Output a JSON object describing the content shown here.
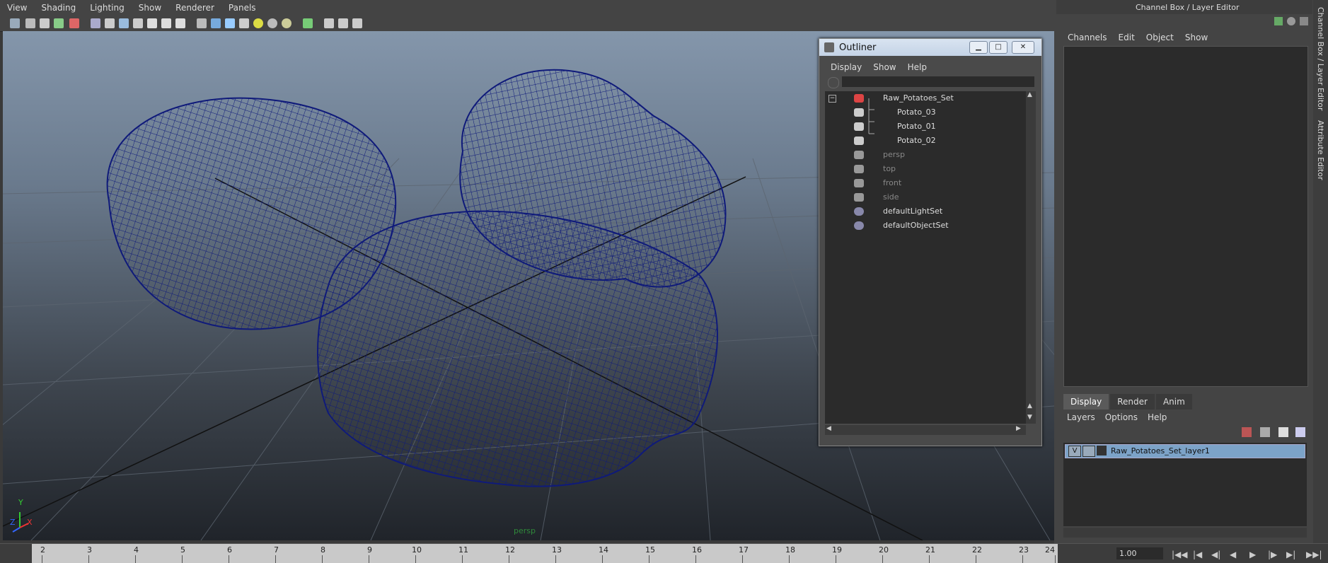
{
  "viewport": {
    "menu": [
      "View",
      "Shading",
      "Lighting",
      "Show",
      "Renderer",
      "Panels"
    ],
    "camera_label": "persp",
    "axis_labels": {
      "y": "Y",
      "x": "X",
      "z": "Z"
    },
    "wire_color": "#0f1a7a"
  },
  "outliner": {
    "title": "Outliner",
    "menu": [
      "Display",
      "Show",
      "Help"
    ],
    "collapse_glyph": "−",
    "items": [
      {
        "label": "Raw_Potatoes_Set",
        "icon": "set-icon",
        "dim": false
      },
      {
        "label": "Potato_03",
        "icon": "mesh-icon",
        "dim": false
      },
      {
        "label": "Potato_01",
        "icon": "mesh-icon",
        "dim": false
      },
      {
        "label": "Potato_02",
        "icon": "mesh-icon",
        "dim": false
      },
      {
        "label": "persp",
        "icon": "camera-icon",
        "dim": true
      },
      {
        "label": "top",
        "icon": "camera-icon",
        "dim": true
      },
      {
        "label": "front",
        "icon": "camera-icon",
        "dim": true
      },
      {
        "label": "side",
        "icon": "camera-icon",
        "dim": true
      },
      {
        "label": "defaultLightSet",
        "icon": "lightset-icon",
        "dim": false
      },
      {
        "label": "defaultObjectSet",
        "icon": "objectset-icon",
        "dim": false
      }
    ]
  },
  "right_panel": {
    "title": "Channel Box / Layer Editor",
    "menu": [
      "Channels",
      "Edit",
      "Object",
      "Show"
    ],
    "tabs": [
      "Display",
      "Render",
      "Anim"
    ],
    "active_tab": "Display",
    "layer_menu": [
      "Layers",
      "Options",
      "Help"
    ],
    "layer": {
      "visibility": "V",
      "name": "Raw_Potatoes_Set_layer1"
    },
    "side_tabs": [
      "Channel Box / Layer Editor",
      "Attribute Editor"
    ]
  },
  "timeline": {
    "ticks": [
      "2",
      "3",
      "4",
      "5",
      "6",
      "7",
      "8",
      "9",
      "10",
      "11",
      "12",
      "13",
      "14",
      "15",
      "16",
      "17",
      "18",
      "19",
      "20",
      "21",
      "22",
      "23",
      "24"
    ],
    "current_frame": "1.00"
  }
}
